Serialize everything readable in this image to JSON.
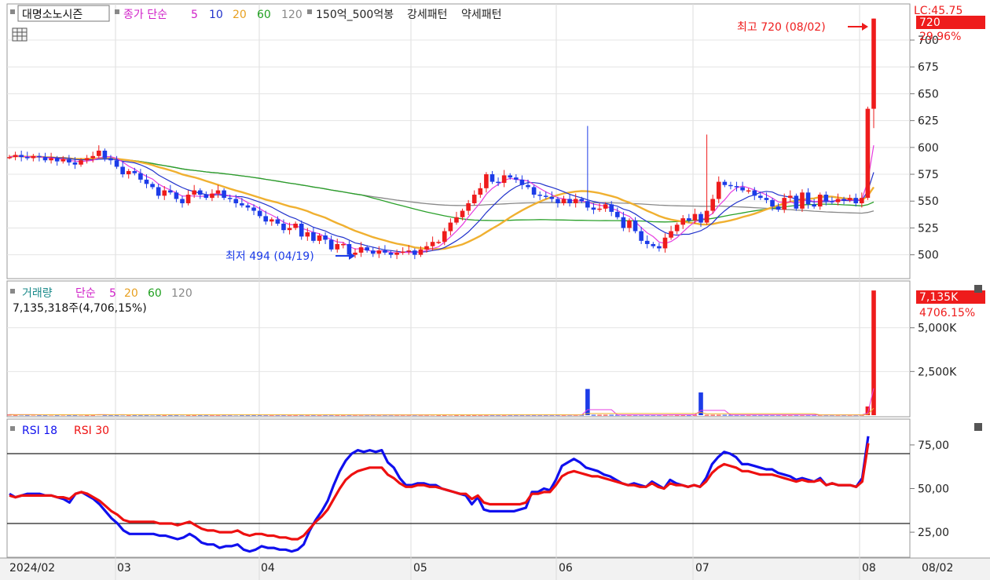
{
  "legend_price": {
    "stock_name": "대명소노시즌",
    "ma_label": "종가 단순",
    "ma_periods": [
      "5",
      "10",
      "20",
      "60",
      "120"
    ],
    "pattern_label": "150억_500억봉",
    "strong_label": "강세패턴",
    "weak_label": "약세패턴"
  },
  "legend_volume": {
    "title": "거래량",
    "ma_label": "단순",
    "ma_periods": [
      "5",
      "20",
      "60",
      "120"
    ],
    "info": "7,135,318주(4,706,15%)"
  },
  "legend_rsi": {
    "rsi1": "RSI 18",
    "rsi2": "RSI 30"
  },
  "price_panel": {
    "header_value": "LC:45.75",
    "current_price": "720",
    "current_change": "29.96%",
    "high_annotation": "최고 720 (08/02)",
    "low_annotation": "최저 494 (04/19)"
  },
  "volume_panel": {
    "current_volume": "7,135K",
    "current_change": "4706.15%"
  },
  "x_axis_labels": [
    "2024/02",
    "03",
    "04",
    "05",
    "06",
    "07",
    "08"
  ],
  "x_axis_right_label": "08/02",
  "colors": {
    "up": "#ee1c1c",
    "down": "#1c3ce8",
    "ma5": "#e63ce0",
    "ma10": "#2233cc",
    "ma20": "#f0b030",
    "ma60": "#2aa02a",
    "ma120": "#888888",
    "rsi18": "#1010ee",
    "rsi30": "#ee1010"
  },
  "chart_data": [
    {
      "type": "candlestick",
      "title": "대명소노시즌",
      "y_ticks": [
        500,
        525,
        550,
        575,
        600,
        625,
        650,
        675,
        700
      ],
      "ylim": [
        480,
        730
      ],
      "high": {
        "value": 720,
        "date": "08/02"
      },
      "low": {
        "value": 494,
        "date": "04/19"
      },
      "ohlc_closes": [
        591,
        593,
        591,
        590,
        592,
        591,
        588,
        590,
        587,
        589,
        586,
        584,
        588,
        590,
        592,
        597,
        590,
        588,
        582,
        575,
        578,
        576,
        570,
        566,
        563,
        555,
        560,
        558,
        552,
        548,
        556,
        560,
        556,
        553,
        557,
        560,
        553,
        552,
        548,
        546,
        544,
        541,
        536,
        531,
        533,
        529,
        523,
        525,
        529,
        517,
        521,
        513,
        518,
        514,
        505,
        510,
        510,
        500,
        502,
        507,
        504,
        501,
        504,
        502,
        500,
        502,
        503,
        504,
        500,
        505,
        508,
        512,
        512,
        522,
        530,
        535,
        541,
        548,
        556,
        562,
        575,
        568,
        567,
        574,
        572,
        570,
        565,
        563,
        556,
        555,
        554,
        552,
        548,
        552,
        548,
        552,
        550,
        544,
        542,
        543,
        547,
        540,
        535,
        525,
        532,
        522,
        513,
        510,
        508,
        506,
        516,
        522,
        528,
        534,
        532,
        538,
        530,
        541,
        552,
        568,
        565,
        564,
        563,
        560,
        560,
        555,
        553,
        551,
        545,
        542,
        553,
        555,
        543,
        558,
        547,
        545,
        556,
        550,
        549,
        552,
        551,
        553,
        548,
        553,
        636,
        720
      ],
      "volume_millions": [
        0.03,
        0.02,
        0.03,
        0.02,
        0.03,
        0.02,
        0.02,
        0.03,
        0.02,
        0.03,
        0.02,
        0.02,
        0.03,
        0.02,
        0.02,
        0.04,
        0.02,
        0.02,
        0.02,
        0.03,
        0.02,
        0.02,
        0.02,
        0.02,
        0.03,
        0.02,
        0.02,
        0.02,
        0.02,
        0.03,
        0.02,
        0.02,
        0.02,
        0.02,
        0.02,
        0.02,
        0.02,
        0.02,
        0.03,
        0.02,
        0.02,
        0.02,
        0.02,
        0.02,
        0.02,
        0.02,
        0.02,
        0.02,
        0.02,
        0.02,
        0.02,
        0.02,
        0.02,
        0.02,
        0.02,
        0.02,
        0.02,
        0.02,
        0.02,
        0.02,
        0.02,
        0.02,
        0.02,
        0.02,
        0.02,
        0.02,
        0.02,
        0.02,
        0.02,
        0.02,
        0.02,
        0.03,
        0.02,
        0.02,
        0.03,
        0.02,
        0.02,
        0.02,
        0.02,
        0.02,
        0.02,
        0.02,
        0.02,
        0.02,
        0.02,
        0.02,
        0.02,
        0.02,
        0.02,
        0.02,
        0.02,
        0.02,
        0.02,
        0.02,
        0.02,
        0.02,
        0.02,
        1.5,
        0.02,
        0.02,
        0.02,
        0.02,
        0.02,
        0.02,
        0.02,
        0.02,
        0.02,
        0.02,
        0.02,
        0.02,
        0.02,
        0.03,
        0.02,
        0.02,
        0.02,
        0.02,
        1.3,
        0.02,
        0.02,
        0.02,
        0.02,
        0.02,
        0.02,
        0.02,
        0.02,
        0.02,
        0.02,
        0.02,
        0.02,
        0.02,
        0.02,
        0.02,
        0.02,
        0.02,
        0.02,
        0.02,
        0.02,
        0.02,
        0.02,
        0.02,
        0.02,
        0.02,
        0.02,
        0.02,
        0.5,
        7.135
      ],
      "volume_y_ticks_label": [
        "2,500K",
        "5,000K"
      ],
      "volume_ylim_millions": [
        0,
        7.5
      ]
    },
    {
      "type": "line",
      "title": "RSI",
      "y_ticks": [
        25,
        50,
        75
      ],
      "y_tick_labels": [
        "25,00",
        "50,00",
        "75,00"
      ],
      "reference_lines": [
        70,
        30
      ],
      "ylim": [
        12,
        88
      ],
      "series": [
        {
          "name": "RSI 18",
          "values": [
            47,
            45,
            46,
            47,
            47,
            47,
            46,
            46,
            45,
            44,
            42,
            47,
            48,
            46,
            44,
            41,
            37,
            33,
            30,
            26,
            24,
            24,
            24,
            24,
            24,
            23,
            23,
            22,
            21,
            22,
            24,
            22,
            19,
            18,
            18,
            16,
            17,
            17,
            18,
            15,
            14,
            15,
            17,
            16,
            16,
            15,
            15,
            14,
            15,
            18,
            26,
            32,
            37,
            43,
            52,
            60,
            66,
            70,
            72,
            71,
            72,
            71,
            72,
            65,
            62,
            56,
            52,
            52,
            53,
            53,
            52,
            52,
            50,
            49,
            48,
            47,
            46,
            41,
            45,
            38,
            37,
            37,
            37,
            37,
            37,
            38,
            39,
            48,
            48,
            50,
            49,
            55,
            63,
            65,
            67,
            65,
            62,
            61,
            60,
            58,
            57,
            55,
            53,
            52,
            53,
            52,
            51,
            54,
            52,
            50,
            55,
            53,
            52,
            51,
            52,
            51,
            56,
            64,
            68,
            71,
            70,
            68,
            64,
            64,
            63,
            62,
            61,
            61,
            59,
            58,
            57,
            55,
            56,
            55,
            54,
            56,
            52,
            53,
            52,
            52,
            52,
            51,
            56,
            80
          ]
        },
        {
          "name": "RSI 30",
          "values": [
            46,
            45,
            46,
            46,
            46,
            46,
            46,
            46,
            45,
            45,
            44,
            47,
            48,
            47,
            45,
            43,
            40,
            37,
            35,
            32,
            31,
            31,
            31,
            31,
            31,
            30,
            30,
            30,
            29,
            30,
            31,
            29,
            27,
            26,
            26,
            25,
            25,
            25,
            26,
            24,
            23,
            24,
            24,
            23,
            23,
            22,
            22,
            21,
            21,
            23,
            27,
            31,
            34,
            38,
            44,
            50,
            55,
            58,
            60,
            61,
            62,
            62,
            62,
            58,
            56,
            53,
            51,
            51,
            52,
            52,
            51,
            51,
            50,
            49,
            48,
            47,
            47,
            44,
            46,
            42,
            41,
            41,
            41,
            41,
            41,
            41,
            42,
            47,
            47,
            48,
            48,
            52,
            57,
            59,
            60,
            59,
            58,
            57,
            57,
            56,
            55,
            54,
            53,
            52,
            52,
            51,
            51,
            53,
            51,
            50,
            53,
            52,
            52,
            51,
            52,
            51,
            54,
            59,
            62,
            64,
            63,
            62,
            60,
            60,
            59,
            58,
            58,
            58,
            57,
            56,
            55,
            54,
            55,
            54,
            54,
            55,
            52,
            53,
            52,
            52,
            52,
            51,
            54,
            76
          ]
        }
      ]
    }
  ]
}
